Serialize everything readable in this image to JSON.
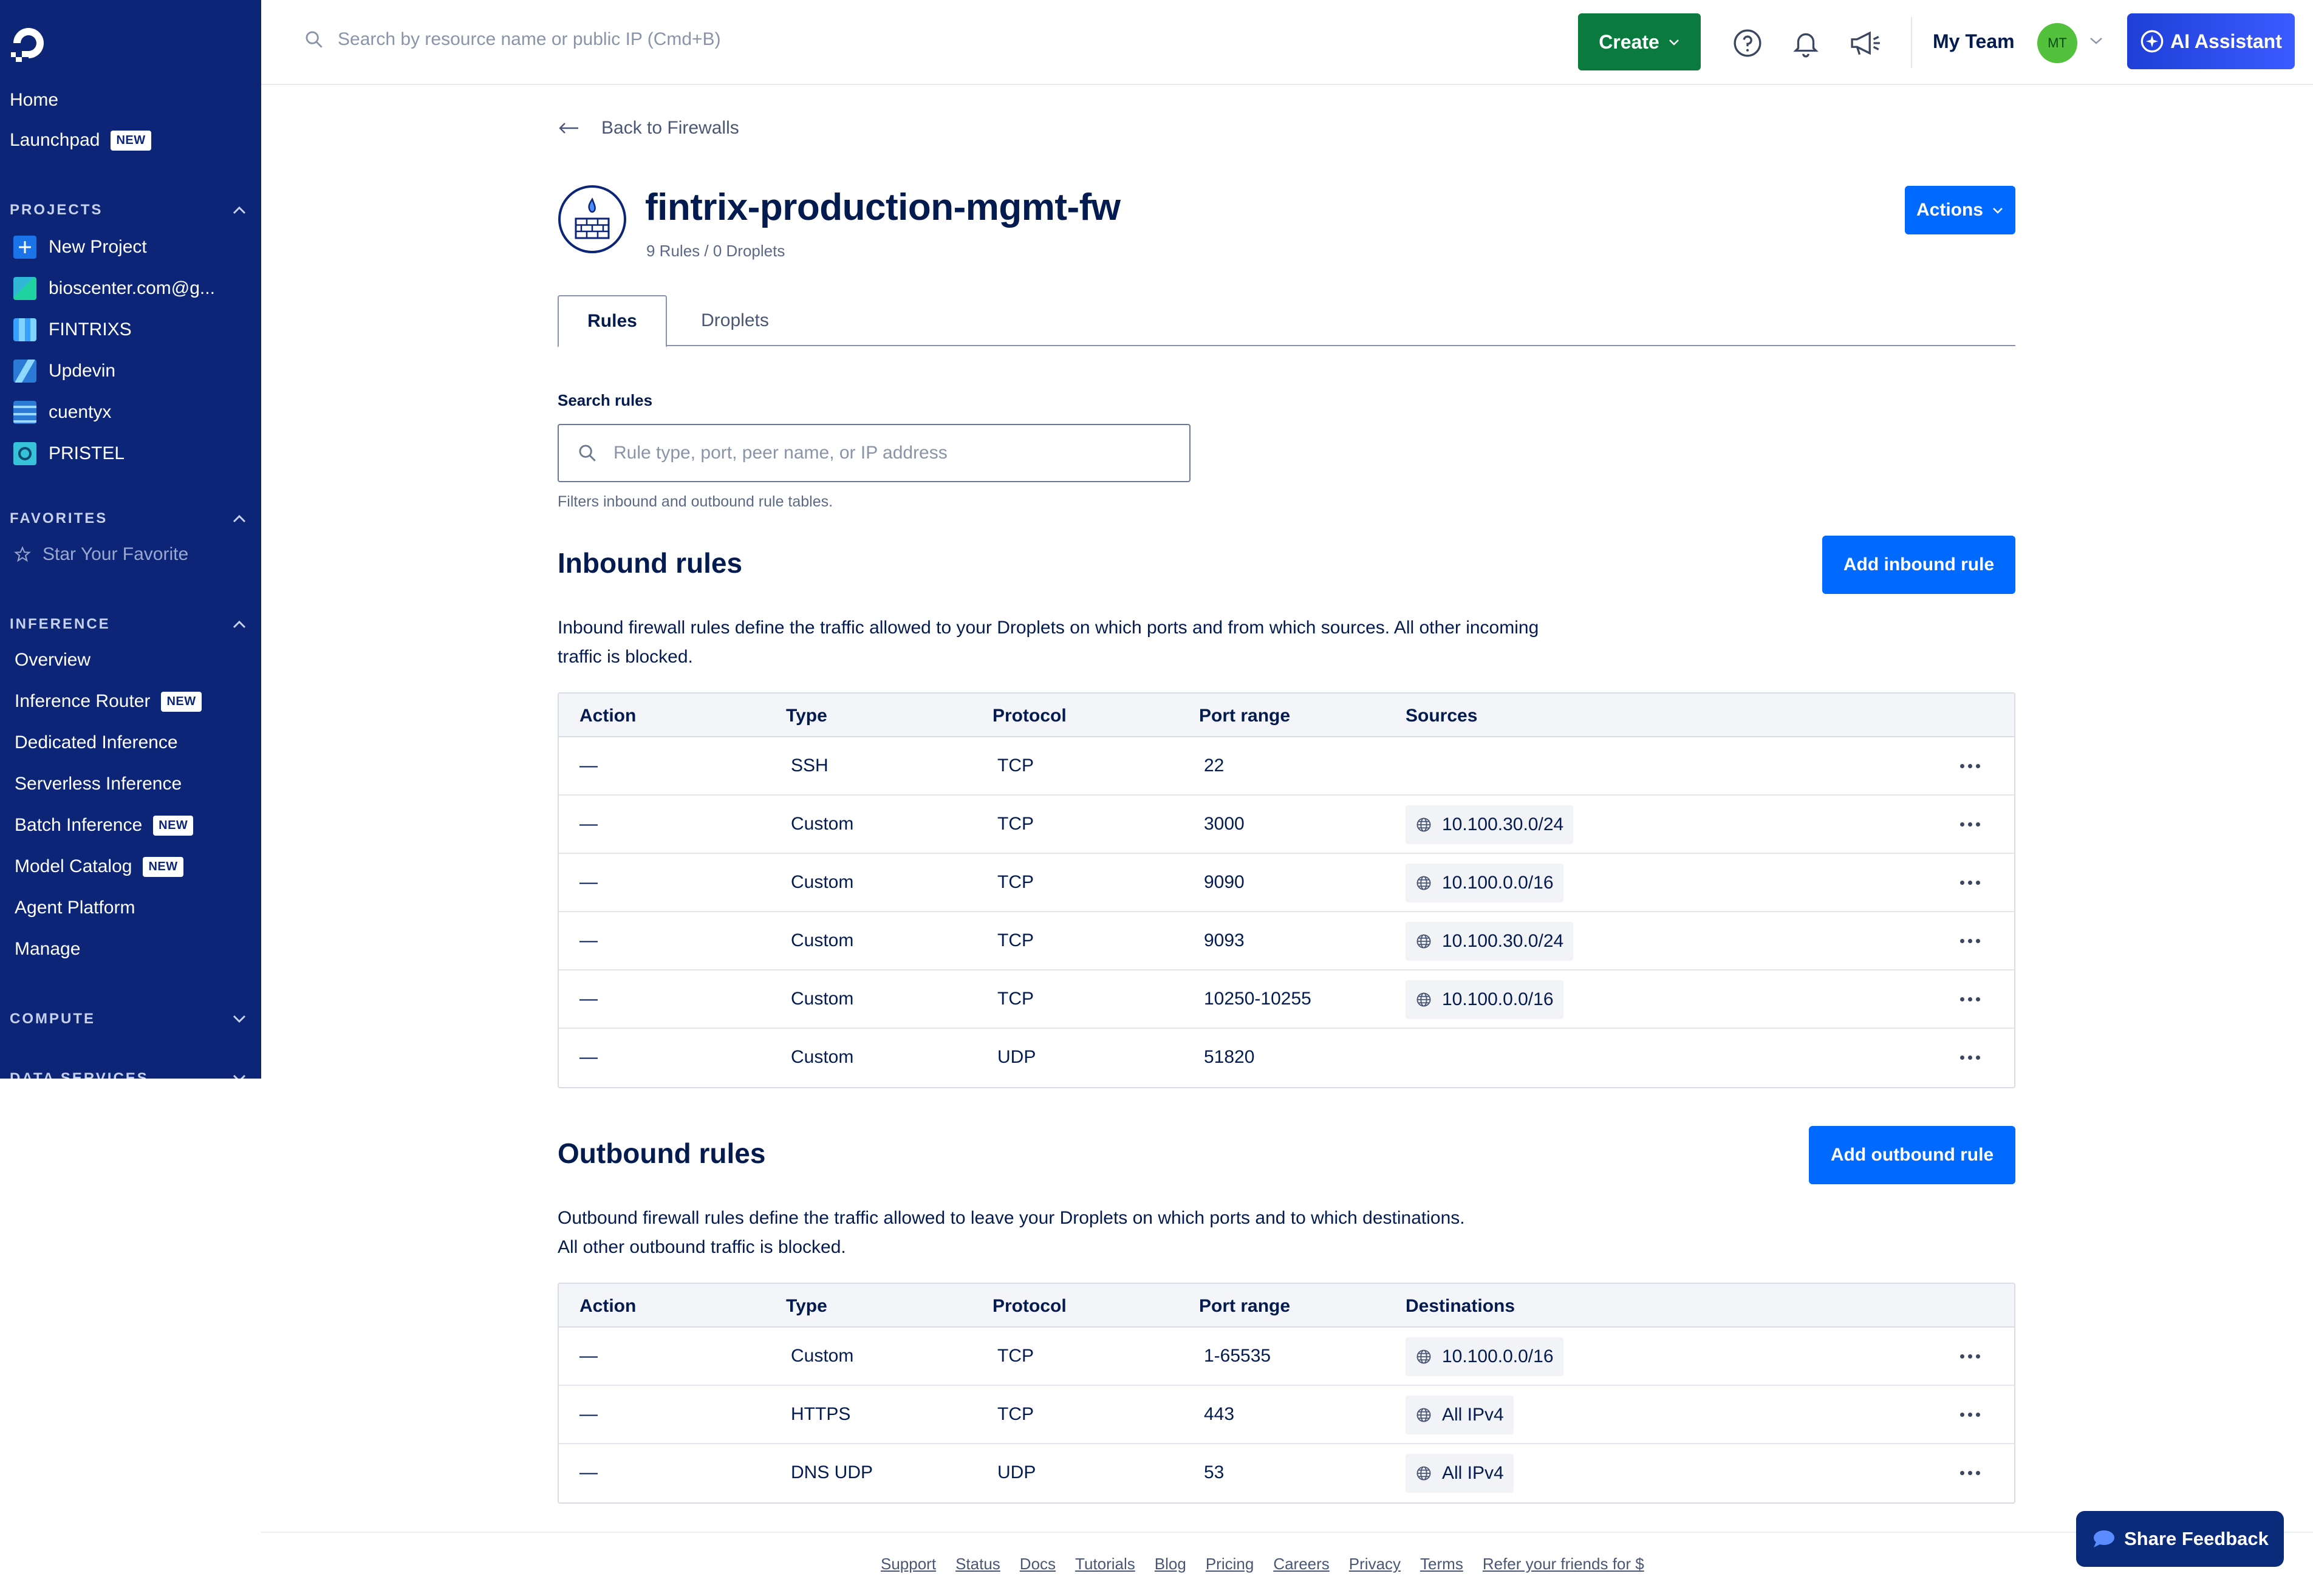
{
  "sidebar": {
    "home": "Home",
    "launchpad": "Launchpad",
    "new_badge": "NEW",
    "projects_head": "PROJECTS",
    "projects": [
      {
        "label": "New Project",
        "icon": "plus-icon",
        "color": "#1a73e8"
      },
      {
        "label": "bioscenter.com@g...",
        "icon": "project-icon",
        "color": "#2fb7d6"
      },
      {
        "label": "FINTRIXS",
        "icon": "project-icon",
        "color": "#3aa0ff"
      },
      {
        "label": "Updevin",
        "icon": "project-icon",
        "color": "#2b7bd6"
      },
      {
        "label": "cuentyx",
        "icon": "project-icon",
        "color": "#2b7bd6"
      },
      {
        "label": "PRISTEL",
        "icon": "project-icon",
        "color": "#36c2d9"
      }
    ],
    "favorites_head": "FAVORITES",
    "star_favorite": "Star Your Favorite",
    "inference_head": "INFERENCE",
    "inference": [
      {
        "label": "Overview",
        "new": false
      },
      {
        "label": "Inference Router",
        "new": true
      },
      {
        "label": "Dedicated Inference",
        "new": false
      },
      {
        "label": "Serverless Inference",
        "new": false
      },
      {
        "label": "Batch Inference",
        "new": true
      },
      {
        "label": "Model Catalog",
        "new": true
      },
      {
        "label": "Agent Platform",
        "new": false
      },
      {
        "label": "Manage",
        "new": false
      }
    ],
    "compute_head": "COMPUTE",
    "data_services_head": "DATA SERVICES"
  },
  "topbar": {
    "search_placeholder": "Search by resource name or public IP (Cmd+B)",
    "create": "Create",
    "team": "My Team",
    "avatar_initials": "MT",
    "ai_assistant": "AI Assistant"
  },
  "page": {
    "back": "Back to Firewalls",
    "title": "fintrix-production-mgmt-fw",
    "subtitle": "9 Rules / 0 Droplets",
    "actions": "Actions",
    "tabs": {
      "rules": "Rules",
      "droplets": "Droplets"
    },
    "search_label": "Search rules",
    "search_placeholder": "Rule type, port, peer name, or IP address",
    "search_help": "Filters inbound and outbound rule tables."
  },
  "inbound": {
    "title": "Inbound rules",
    "add": "Add inbound rule",
    "description": "Inbound firewall rules define the traffic allowed to your Droplets on which ports and from which sources. All other incoming traffic is blocked.",
    "columns": {
      "action": "Action",
      "type": "Type",
      "protocol": "Protocol",
      "port": "Port range",
      "peer": "Sources"
    },
    "rows": [
      {
        "action": "—",
        "type": "SSH",
        "protocol": "TCP",
        "port": "22",
        "peer": ""
      },
      {
        "action": "—",
        "type": "Custom",
        "protocol": "TCP",
        "port": "3000",
        "peer": "10.100.30.0/24"
      },
      {
        "action": "—",
        "type": "Custom",
        "protocol": "TCP",
        "port": "9090",
        "peer": "10.100.0.0/16"
      },
      {
        "action": "—",
        "type": "Custom",
        "protocol": "TCP",
        "port": "9093",
        "peer": "10.100.30.0/24"
      },
      {
        "action": "—",
        "type": "Custom",
        "protocol": "TCP",
        "port": "10250-10255",
        "peer": "10.100.0.0/16"
      },
      {
        "action": "—",
        "type": "Custom",
        "protocol": "UDP",
        "port": "51820",
        "peer": ""
      }
    ]
  },
  "outbound": {
    "title": "Outbound rules",
    "add": "Add outbound rule",
    "description_line1": "Outbound firewall rules define the traffic allowed to leave your Droplets on which ports and to which destinations.",
    "description_line2": "All other outbound traffic is blocked.",
    "columns": {
      "action": "Action",
      "type": "Type",
      "protocol": "Protocol",
      "port": "Port range",
      "peer": "Destinations"
    },
    "rows": [
      {
        "action": "—",
        "type": "Custom",
        "protocol": "TCP",
        "port": "1-65535",
        "peer": "10.100.0.0/16"
      },
      {
        "action": "—",
        "type": "HTTPS",
        "protocol": "TCP",
        "port": "443",
        "peer": "All IPv4"
      },
      {
        "action": "—",
        "type": "DNS UDP",
        "protocol": "UDP",
        "port": "53",
        "peer": "All IPv4"
      }
    ]
  },
  "footer": {
    "links": [
      "Support",
      "Status",
      "Docs",
      "Tutorials",
      "Blog",
      "Pricing",
      "Careers",
      "Privacy",
      "Terms",
      "Refer your friends for $"
    ]
  },
  "feedback": "Share Feedback"
}
